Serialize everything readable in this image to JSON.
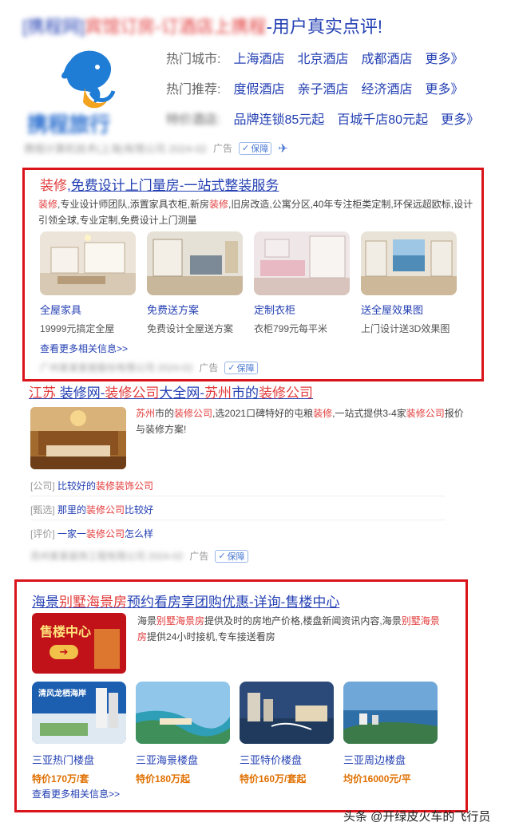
{
  "result1": {
    "title_prefix": "[携程网]",
    "title_mid": "宾馆订房-订酒店上携程",
    "title_suffix": "-用户真实点评!",
    "brand_text": "携程旅行",
    "rows": [
      {
        "label": "热门城市:",
        "items": [
          "上海酒店",
          "北京酒店",
          "成都酒店",
          "更多》"
        ]
      },
      {
        "label": "热门推荐:",
        "items": [
          "度假酒店",
          "亲子酒店",
          "经济酒店",
          "更多》"
        ]
      },
      {
        "label": "特价酒店:",
        "items": [
          "品牌连锁85元起",
          "百城千店80元起",
          "更多》"
        ]
      }
    ],
    "meta_blur": "携程计算机技术(上海)有限公司 2024-02",
    "ad_label": "广告",
    "guard_label": "保障"
  },
  "ad1": {
    "title_hl": "装修",
    "title_rest": ",免费设计上门量房-一站式整装服务",
    "desc_parts": [
      {
        "t": "装修",
        "hl": true
      },
      {
        "t": ",专业设计师团队,添置家具衣柜,新房",
        "hl": false
      },
      {
        "t": "装修",
        "hl": true
      },
      {
        "t": ",旧房改造,公寓分区,40年专注柜类定制,环保远超欧标,设计引领全球,专业定制,免费设计上门测量",
        "hl": false
      }
    ],
    "tiles": [
      {
        "title": "全屋家具",
        "sub": "19999元搞定全屋"
      },
      {
        "title": "免费送方案",
        "sub": "免费设计全屋送方案"
      },
      {
        "title": "定制衣柜",
        "sub": "衣柜799元每平米"
      },
      {
        "title": "送全屋效果图",
        "sub": "上门设计送3D效果图"
      }
    ],
    "more": "查看更多相关信息>>",
    "meta_blur": "广州某某家居股份有限公司 2024-02",
    "ad_label": "广告",
    "guard_label": "保障"
  },
  "result2": {
    "title_parts": [
      {
        "t": "江苏",
        "hl": true
      },
      {
        "t": " 装修网-",
        "hl": false
      },
      {
        "t": "装修公司",
        "hl": true
      },
      {
        "t": "大全网-",
        "hl": false
      },
      {
        "t": "苏州",
        "hl": true
      },
      {
        "t": "市的",
        "hl": false
      },
      {
        "t": "装修公司",
        "hl": true
      }
    ],
    "desc_parts": [
      {
        "t": "苏州",
        "hl": true
      },
      {
        "t": "市的",
        "hl": false
      },
      {
        "t": "装修公司",
        "hl": true
      },
      {
        "t": ",选2021口碑特好的屯粮",
        "hl": false
      },
      {
        "t": "装修",
        "hl": true
      },
      {
        "t": ",一站式提供3-4家",
        "hl": false
      },
      {
        "t": "装修公司",
        "hl": true
      },
      {
        "t": "报价与装修方案!",
        "hl": false
      }
    ],
    "sub_rows": [
      {
        "tag": "[公司]",
        "pre": "比较好的",
        "hl": "装修装饰公司",
        "post": ""
      },
      {
        "tag": "[甄选]",
        "pre": "那里的",
        "hl": "装修公司",
        "post": "比较好"
      },
      {
        "tag": "[评价]",
        "pre": "一家一",
        "hl": "装修公司",
        "post": "怎么样"
      }
    ],
    "meta_blur": "苏州某某装饰工程有限公司 2024-02",
    "ad_label": "广告",
    "guard_label": "保障"
  },
  "ad3": {
    "title_parts": [
      {
        "t": "海景",
        "hl": false
      },
      {
        "t": "别墅",
        "hl": true
      },
      {
        "t": "海景房",
        "hl": true
      },
      {
        "t": "预约看房享团购优惠-详询-售楼中心",
        "hl": false
      }
    ],
    "img_text": "售楼中心",
    "desc_parts": [
      {
        "t": "海景",
        "hl": false
      },
      {
        "t": "别墅海景房",
        "hl": true
      },
      {
        "t": "提供及时的房地产价格,楼盘新闻资讯内容,海景",
        "hl": false
      },
      {
        "t": "别墅海景房",
        "hl": true
      },
      {
        "t": "提供24小时接机,专车接送看房",
        "hl": false
      }
    ],
    "tiles": [
      {
        "title": "三亚热门楼盘",
        "sub": "特价170万/套"
      },
      {
        "title": "三亚海景楼盘",
        "sub": "特价180万起"
      },
      {
        "title": "三亚特价楼盘",
        "sub": "特价160万/套起"
      },
      {
        "title": "三亚周边楼盘",
        "sub": "均价16000元/平"
      }
    ],
    "tile1_text": "清风龙栖海岸",
    "more": "查看更多相关信息>>"
  },
  "watermark": "头条 @开绿皮火车的飞行员",
  "colors": {
    "red_box": "#d9141b",
    "link": "#2440b3",
    "highlight": "#e23a3a",
    "price": "#e07000"
  }
}
